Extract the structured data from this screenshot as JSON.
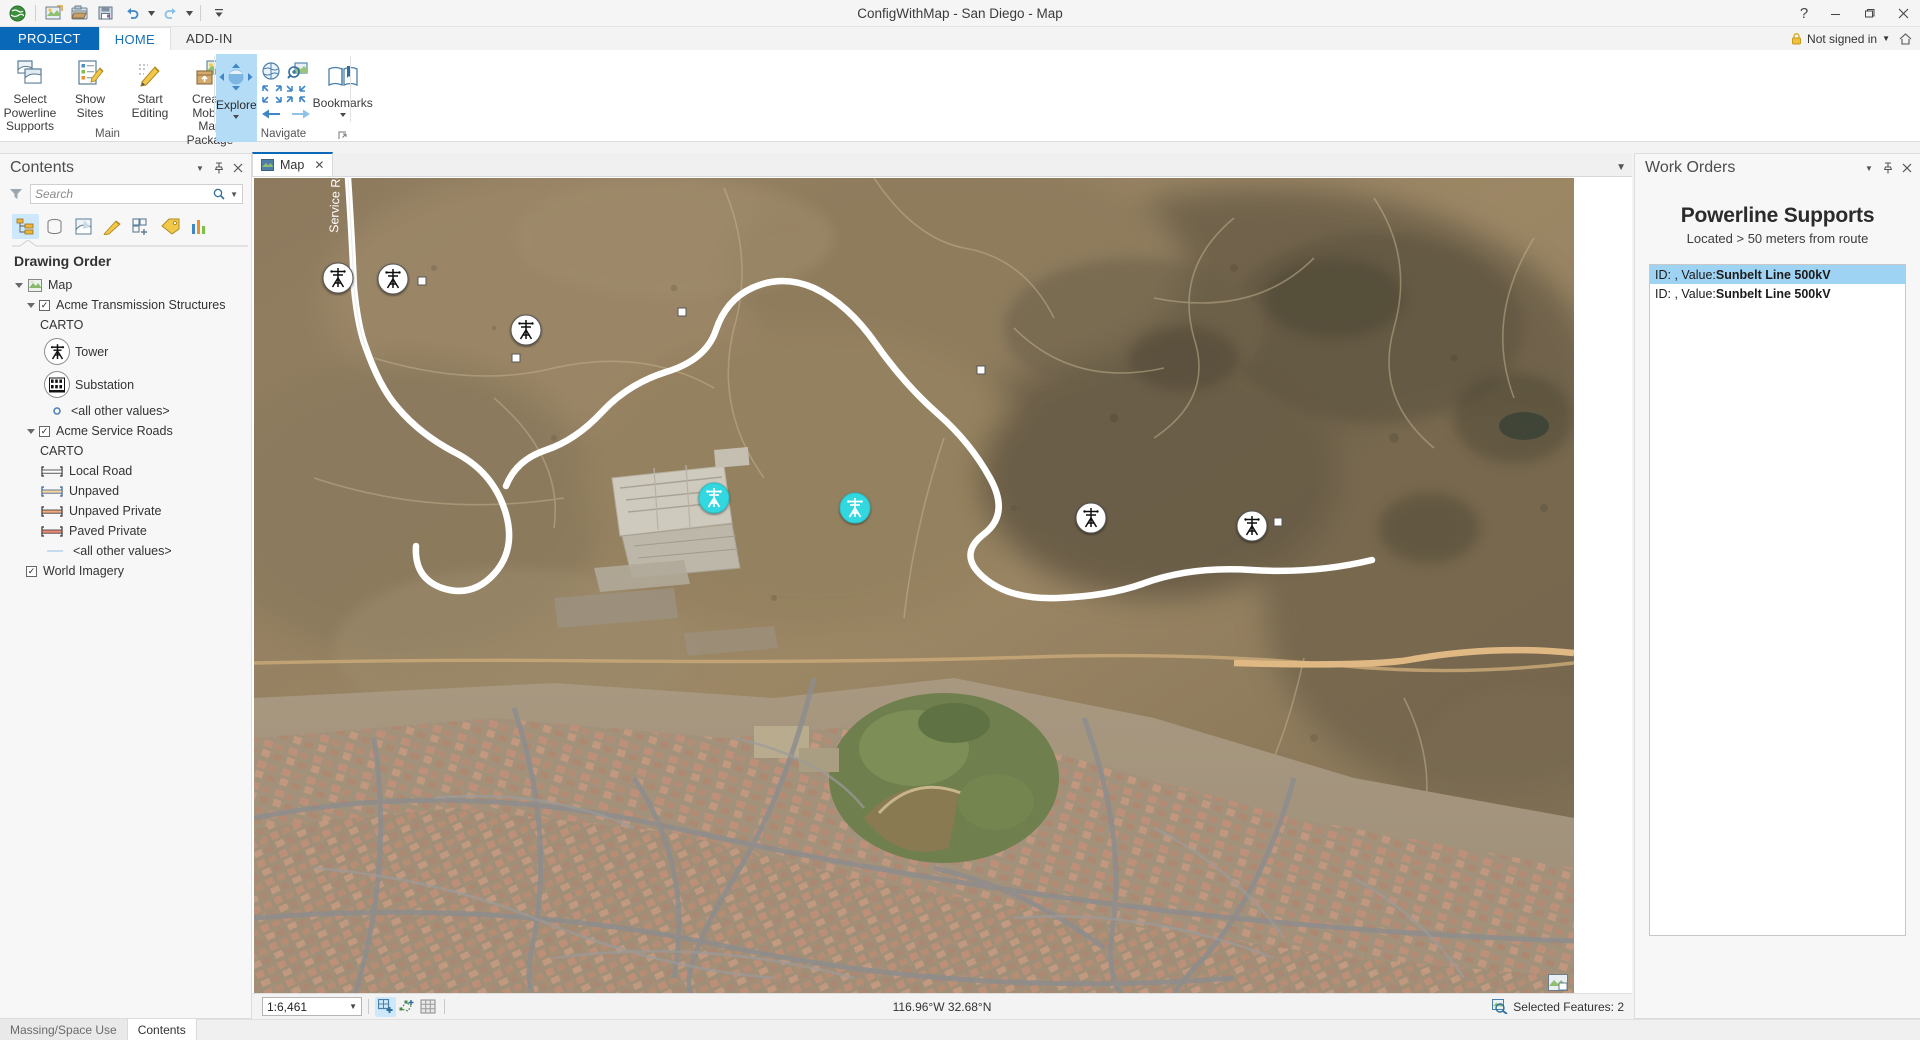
{
  "window": {
    "title": "ConfigWithMap - San Diego - Map",
    "help_icon": "help-icon",
    "minimize_icon": "minimize-icon",
    "restore_icon": "restore-icon",
    "close_icon": "close-icon"
  },
  "quick_access": [
    {
      "name": "arcgis-globe-icon",
      "glyph": "globe"
    },
    {
      "name": "new-map-icon",
      "glyph": "newmap"
    },
    {
      "name": "open-project-icon",
      "glyph": "open"
    },
    {
      "name": "save-project-icon",
      "glyph": "save"
    },
    {
      "name": "undo-icon",
      "glyph": "undo"
    },
    {
      "name": "redo-icon",
      "glyph": "redo"
    },
    {
      "name": "customize-qat-icon",
      "glyph": "more"
    }
  ],
  "tabs": [
    {
      "label": "PROJECT",
      "state": "project"
    },
    {
      "label": "HOME",
      "state": "active"
    },
    {
      "label": "ADD-IN",
      "state": "normal"
    }
  ],
  "account": {
    "label": "Not signed in",
    "lock_icon": "lock-icon",
    "caret_icon": "chevron-down-icon",
    "home_icon": "home-icon"
  },
  "ribbon": {
    "groups": [
      {
        "label": "Main",
        "buttons": [
          {
            "label": "Select Powerline\nSupports",
            "icon": "select-features-icon"
          },
          {
            "label": "Show\nSites",
            "icon": "show-sites-icon"
          },
          {
            "label": "Start\nEditing",
            "icon": "start-editing-icon"
          },
          {
            "label": "Create Mobile\nMap Package",
            "icon": "create-mobile-map-package-icon"
          }
        ]
      },
      {
        "label": "Navigate",
        "explore": {
          "label": "Explore",
          "icon": "explore-icon",
          "caret": "chevron-down-icon"
        },
        "tools": [
          {
            "name": "full-extent-icon"
          },
          {
            "name": "bookmark-zoom-icon"
          },
          {
            "name": "fixed-zoom-in-icon"
          },
          {
            "name": "fixed-zoom-out-icon"
          },
          {
            "name": "previous-extent-icon"
          },
          {
            "name": "next-extent-icon"
          }
        ],
        "bookmarks": {
          "label": "Bookmarks",
          "icon": "bookmarks-icon",
          "caret": "chevron-down-icon"
        },
        "dialog_launcher": "dialog-launcher-icon"
      }
    ]
  },
  "contents": {
    "title": "Contents",
    "header_buttons": [
      "chevron-down-icon",
      "pin-icon",
      "close-icon"
    ],
    "search": {
      "placeholder": "Search",
      "icon": "search-icon",
      "filter_icon": "filter-icon",
      "caret": "chevron-down-icon"
    },
    "toolbar": [
      {
        "name": "list-by-drawing-order-icon",
        "selected": true
      },
      {
        "name": "list-by-data-source-icon",
        "selected": false
      },
      {
        "name": "list-by-selection-icon",
        "selected": false
      },
      {
        "name": "list-by-editing-icon",
        "selected": false
      },
      {
        "name": "list-by-snapping-icon",
        "selected": false
      },
      {
        "name": "list-by-labeling-icon",
        "selected": false
      },
      {
        "name": "list-by-charts-icon",
        "selected": false
      }
    ],
    "drawing_order_label": "Drawing Order",
    "tree": [
      {
        "level": 0,
        "label": "Map",
        "type": "map",
        "expander": true
      },
      {
        "level": 1,
        "label": "Acme Transmission Structures",
        "type": "layer",
        "checked": true,
        "expander": true
      },
      {
        "level": 2,
        "label": "CARTO",
        "type": "heading"
      },
      {
        "level": 3,
        "label": "Tower",
        "type": "symbol-tower"
      },
      {
        "level": 3,
        "label": "Substation",
        "type": "symbol-substation"
      },
      {
        "level": 3,
        "label": "<all other values>",
        "type": "symbol-dot"
      },
      {
        "level": 1,
        "label": "Acme Service Roads",
        "type": "layer",
        "checked": true,
        "expander": true
      },
      {
        "level": 2,
        "label": "CARTO",
        "type": "heading"
      },
      {
        "level": 3,
        "label": "Local Road",
        "type": "symbol-line",
        "color": "#ffffff"
      },
      {
        "level": 3,
        "label": "Unpaved",
        "type": "symbol-line",
        "color": "#f7d79b"
      },
      {
        "level": 3,
        "label": "Unpaved Private",
        "type": "symbol-line",
        "color": "#f4a97a"
      },
      {
        "level": 3,
        "label": "Paved Private",
        "type": "symbol-line",
        "color": "#f08a78"
      },
      {
        "level": 3,
        "label": "<all other values>",
        "type": "symbol-plainline",
        "color": "#bfd7ee"
      },
      {
        "level": 1,
        "label": "World Imagery",
        "type": "layer",
        "checked": true
      }
    ]
  },
  "map": {
    "tab_label": "Map",
    "tab_icon": "map-icon",
    "close_icon": "close-icon",
    "tab_menu_icon": "chevron-down-icon",
    "status": {
      "scale": "1:6,461",
      "scale_caret": "chevron-down-icon",
      "tools": [
        {
          "name": "add-selection-icon",
          "selected": true
        },
        {
          "name": "edit-vertices-icon",
          "selected": false
        },
        {
          "name": "grid-icon",
          "selected": false
        }
      ],
      "coordinates": "116.96°W 32.68°N",
      "selected_features_label": "Selected Features: 2",
      "selected_features_icon": "selection-icon",
      "overview_icon": "map-overview-icon"
    },
    "labels": {
      "service_road": "Service Road"
    }
  },
  "work_orders": {
    "title": "Work Orders",
    "header_buttons": [
      "chevron-down-icon",
      "pin-icon",
      "close-icon"
    ],
    "heading": "Powerline Supports",
    "subheading": "Located > 50 meters from route",
    "items": [
      {
        "prefix": "ID: , Value: ",
        "value": "Sunbelt Line 500kV",
        "selected": true
      },
      {
        "prefix": "ID: , Value: ",
        "value": "Sunbelt Line 500kV",
        "selected": false
      }
    ]
  },
  "bottom_tabs": [
    {
      "label": "Massing/Space Use",
      "active": false
    },
    {
      "label": "Contents",
      "active": true
    }
  ],
  "colors": {
    "accent": "#0a68b8",
    "selection": "#9fd3f3",
    "highlight": "#cde8fa",
    "selected_point": "#32d7e0"
  }
}
